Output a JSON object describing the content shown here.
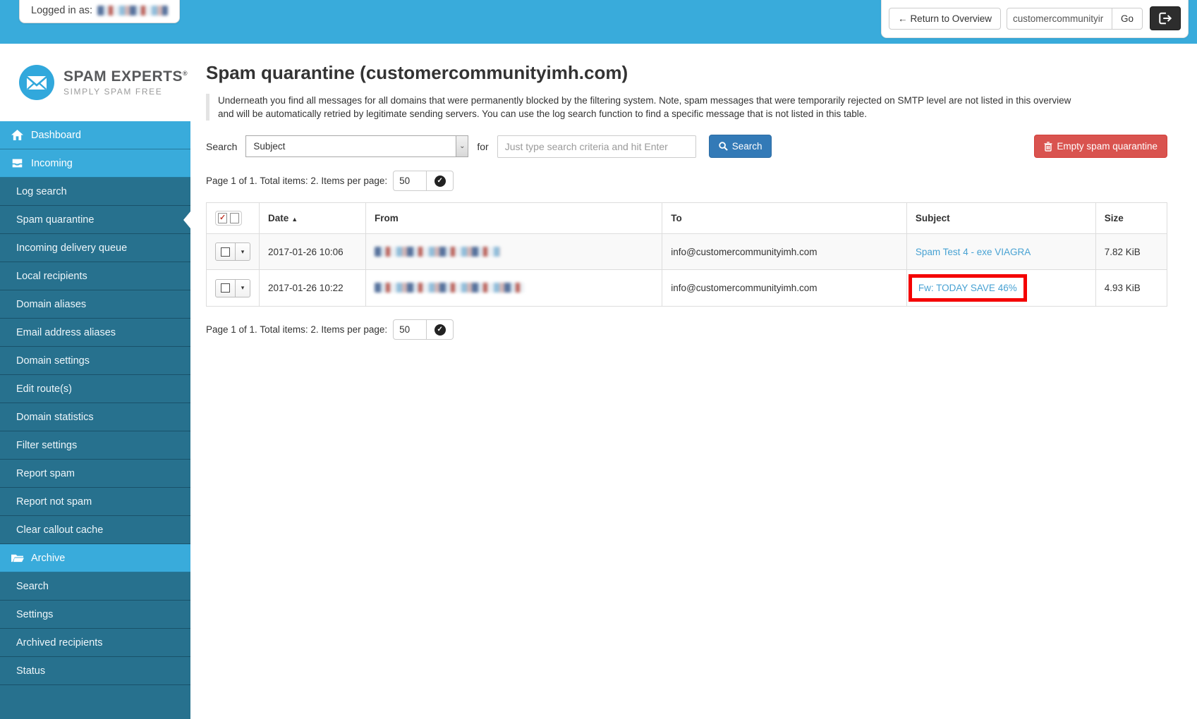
{
  "topbar": {
    "logged_in_label": "Logged in as:",
    "return_button_label": "Return to Overview",
    "return_arrow": "←",
    "domain_input_value": "customercommunityir",
    "go_button_label": "Go"
  },
  "sidebar": {
    "brand_title": "SPAM EXPERTS",
    "brand_reg": "®",
    "brand_tagline": "SIMPLY SPAM FREE",
    "items": [
      {
        "label": "Dashboard"
      },
      {
        "label": "Incoming"
      },
      {
        "label": "Log search"
      },
      {
        "label": "Spam quarantine"
      },
      {
        "label": "Incoming delivery queue"
      },
      {
        "label": "Local recipients"
      },
      {
        "label": "Domain aliases"
      },
      {
        "label": "Email address aliases"
      },
      {
        "label": "Domain settings"
      },
      {
        "label": "Edit route(s)"
      },
      {
        "label": "Domain statistics"
      },
      {
        "label": "Filter settings"
      },
      {
        "label": "Report spam"
      },
      {
        "label": "Report not spam"
      },
      {
        "label": "Clear callout cache"
      },
      {
        "label": "Archive"
      },
      {
        "label": "Search"
      },
      {
        "label": "Settings"
      },
      {
        "label": "Archived recipients"
      },
      {
        "label": "Status"
      }
    ],
    "active_item": "Spam quarantine"
  },
  "main": {
    "title": "Spam quarantine (customercommunityimh.com)",
    "description": "Underneath you find all messages for all domains that were permanently blocked by the filtering system. Note, spam messages that were temporarily rejected on SMTP level are not listed in this overview and will be automatically retried by legitimate sending servers. You can use the log search function to find a specific message that is not listed in this table.",
    "search": {
      "label": "Search",
      "selected_field": "Subject",
      "select_arrow": "⌄",
      "for_label": "for",
      "placeholder": "Just type search criteria and hit Enter",
      "button_label": "Search"
    },
    "empty_button_label": "Empty spam quarantine",
    "pagination": {
      "text": "Page 1 of 1. Total items: 2. Items per page:",
      "page_size": "50",
      "apply_glyph": "✓"
    },
    "table": {
      "headers": {
        "date": "Date",
        "sort_arrow": "▲",
        "from": "From",
        "to": "To",
        "subject": "Subject",
        "size": "Size"
      },
      "caret_glyph": "▾",
      "rows": [
        {
          "date": "2017-01-26 10:06",
          "to": "info@customercommunityimh.com",
          "subject": "Spam Test 4 - exe VIAGRA",
          "size": "7.82 KiB",
          "highlighted": false
        },
        {
          "date": "2017-01-26 10:22",
          "to": "info@customercommunityimh.com",
          "subject": "Fw: TODAY SAVE 46%",
          "size": "4.93 KiB",
          "highlighted": true
        }
      ]
    }
  },
  "colors": {
    "topbar_blue": "#39abdb",
    "sidebar_teal": "#27718e",
    "link_blue": "#48a2d3",
    "primary_button_blue": "#337ab7",
    "danger_red": "#d9534f",
    "annotation_red": "#f40000",
    "logout_dark": "#2d2d2d"
  }
}
